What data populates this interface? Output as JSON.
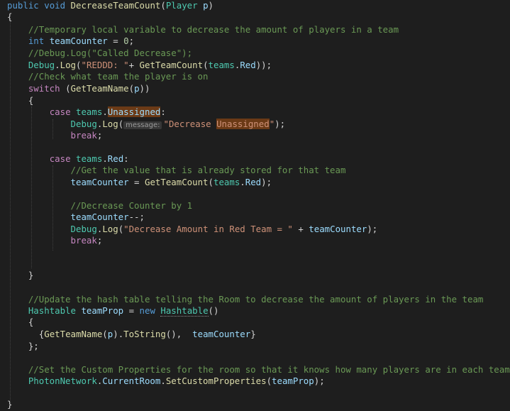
{
  "code": {
    "l1": {
      "t1": "public",
      "t2": "void",
      "t3": "DecreaseTeamCount",
      "t4": "(",
      "t5": "Player",
      "t6": "p",
      "t7": ")"
    },
    "l2": {
      "t1": "{"
    },
    "l3": {
      "t1": "//Temporary local variable to decrease the amount of players in a team"
    },
    "l4": {
      "t1": "int",
      "t2": "teamCounter",
      "t3": " = ",
      "t4": "0",
      "t5": ";"
    },
    "l5": {
      "t1": "//Debug.Log(\"Called Decrease\");"
    },
    "l6": {
      "t1": "Debug",
      "t2": ".",
      "t3": "Log",
      "t4": "(",
      "t5": "\"REDDD: \"",
      "t6": "+ ",
      "t7": "GetTeamCount",
      "t8": "(",
      "t9": "teams",
      "t10": ".",
      "t11": "Red",
      "t12": "));"
    },
    "l7": {
      "t1": "//Check what team the player is on"
    },
    "l8": {
      "t1": "switch",
      "t2": " (",
      "t3": "GetTeamName",
      "t4": "(",
      "t5": "p",
      "t6": "))"
    },
    "l9": {
      "t1": "{"
    },
    "l10": {
      "t1": "case",
      "t2": "teams",
      "t3": ".",
      "t4": "Unassigned",
      "t5": ":"
    },
    "l11": {
      "t1": "Debug",
      "t2": ".",
      "t3": "Log",
      "t4": "(",
      "hint": "message:",
      "t5": "\"Decrease ",
      "t6": "Unassigned",
      "t7": "\"",
      "t8": ");"
    },
    "l12": {
      "t1": "break",
      "t2": ";"
    },
    "l13": {
      "t1": "case",
      "t2": "teams",
      "t3": ".",
      "t4": "Red",
      "t5": ":"
    },
    "l14": {
      "t1": "//Get the value that is already stored for that team"
    },
    "l15": {
      "t1": "teamCounter",
      "t2": " = ",
      "t3": "GetTeamCount",
      "t4": "(",
      "t5": "teams",
      "t6": ".",
      "t7": "Red",
      "t8": ");"
    },
    "l16": {
      "t1": "//Decrease Counter by 1"
    },
    "l17": {
      "t1": "teamCounter",
      "t2": "--;"
    },
    "l18": {
      "t1": "Debug",
      "t2": ".",
      "t3": "Log",
      "t4": "(",
      "t5": "\"Decrease Amount in Red Team = \"",
      "t6": " + ",
      "t7": "teamCounter",
      "t8": ");"
    },
    "l19": {
      "t1": "break",
      "t2": ";"
    },
    "l20": {
      "t1": "}"
    },
    "l21": {
      "t1": "//Update the hash table telling the Room to decrease the amount of players in the team"
    },
    "l22": {
      "t1": "Hashtable",
      "t2": "teamProp",
      "t3": " = ",
      "t4": "new",
      "t5": "Hashtable",
      "t6": "()"
    },
    "l23": {
      "t1": "{"
    },
    "l24": {
      "t1": "{",
      "t2": "GetTeamName",
      "t3": "(",
      "t4": "p",
      "t5": ").",
      "t6": "ToString",
      "t7": "(),  ",
      "t8": "teamCounter",
      "t9": "}"
    },
    "l25": {
      "t1": "};"
    },
    "l26": {
      "t1": "//Set the Custom Properties for the room so that it knows how many players are in each team"
    },
    "l27": {
      "t1": "PhotonNetwork",
      "t2": ".",
      "t3": "CurrentRoom",
      "t4": ".",
      "t5": "SetCustomProperties",
      "t6": "(",
      "t7": "teamProp",
      "t8": ");"
    },
    "l28": {
      "t1": "}"
    }
  },
  "colors": {
    "background": "#1e1e1e",
    "keyword": "#569cd6",
    "control": "#c586c0",
    "function": "#dcdcaa",
    "type": "#4ec9b0",
    "variable": "#9cdcfe",
    "string": "#ce9178",
    "comment": "#6a9955"
  }
}
